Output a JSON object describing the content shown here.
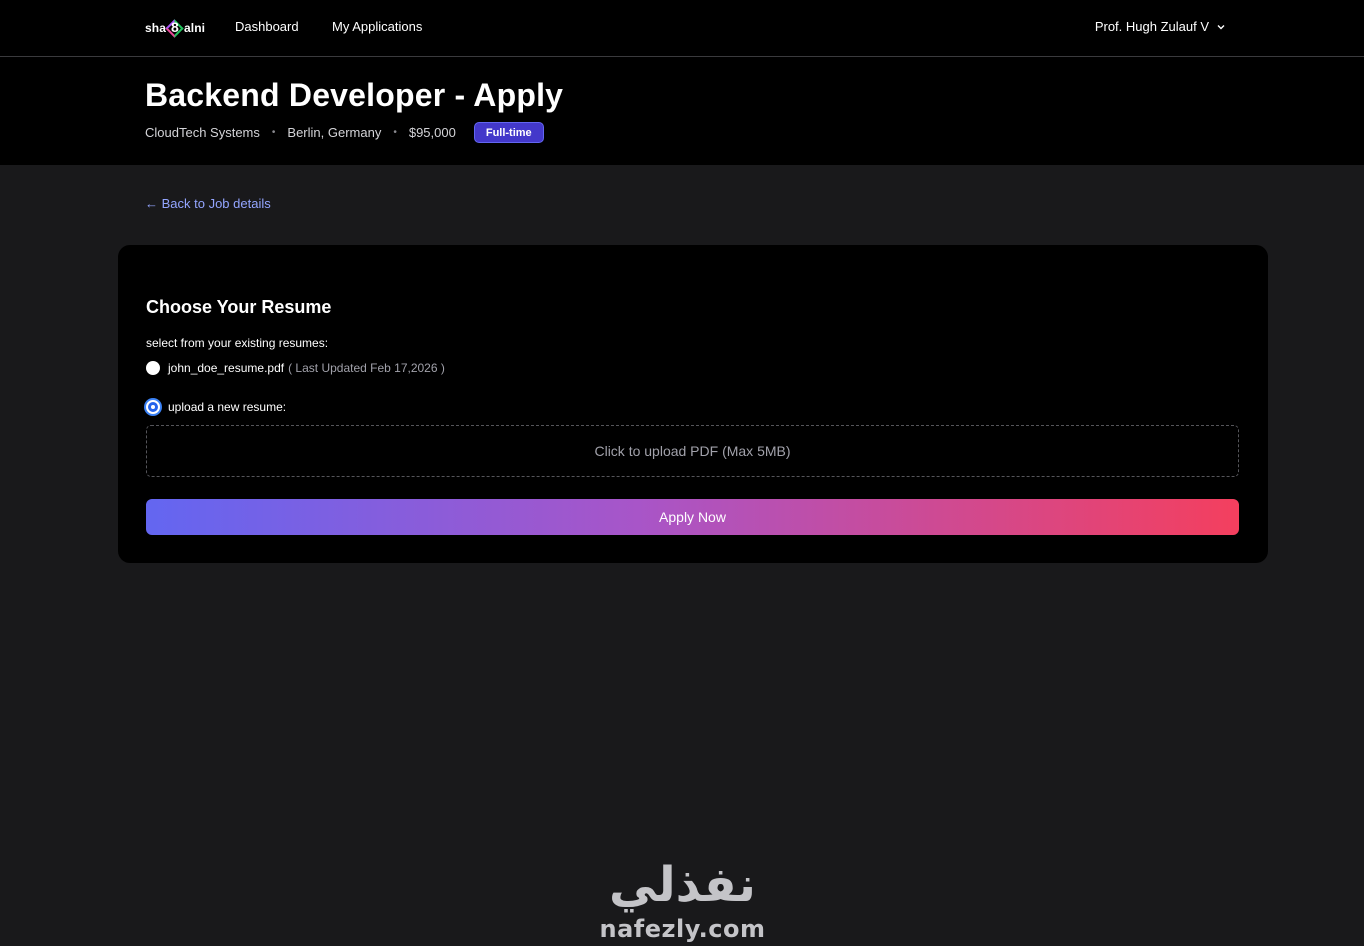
{
  "nav": {
    "logo_left": "sha",
    "logo_mark": "8",
    "logo_right": "alni",
    "links": [
      "Dashboard",
      "My Applications"
    ],
    "user_name": "Prof. Hugh Zulauf V"
  },
  "job": {
    "title": "Backend Developer - Apply",
    "company": "CloudTech Systems",
    "location": "Berlin, Germany",
    "salary": "$95,000",
    "type_badge": "Full-time"
  },
  "back_link": "← Back to Job details",
  "resume_card": {
    "title": "Choose Your Resume",
    "select_label": "select from your existing resumes:",
    "existing_resume": {
      "file_name": "john_doe_resume.pdf",
      "updated": "( Last Updated Feb 17,2026 )",
      "selected": false
    },
    "upload_option": {
      "label": "upload a new resume:",
      "selected": true
    },
    "upload_placeholder": "Click to upload PDF (Max 5MB)",
    "apply_button": "Apply Now"
  },
  "watermark": {
    "arabic": "نفذلي",
    "latin": "nafezly.com"
  },
  "colors": {
    "accent_badge": "#4338ca",
    "link": "#93a5ff",
    "gradient_start": "#6366f1",
    "gradient_end": "#f43f5e"
  }
}
